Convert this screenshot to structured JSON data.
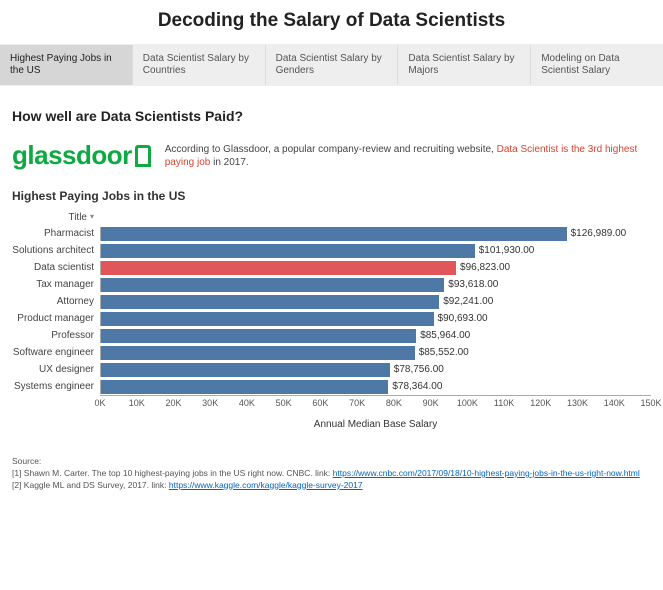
{
  "page_title": "Decoding the Salary of Data Scientists",
  "tabs": [
    {
      "label": "Highest Paying Jobs in the US",
      "active": true
    },
    {
      "label": "Data Scientist Salary by Countries",
      "active": false
    },
    {
      "label": "Data Scientist Salary by Genders",
      "active": false
    },
    {
      "label": "Data Scientist Salary by Majors",
      "active": false
    },
    {
      "label": "Modeling on Data Scientist Salary",
      "active": false
    }
  ],
  "section_heading": "How well are Data Scientists Paid?",
  "glassdoor": {
    "logo_text": "glassdoor",
    "desc_prefix": "According to Glassdoor, a popular company-review and recruiting website, ",
    "desc_highlight": "Data Scientist is the 3rd highest paying job",
    "desc_suffix": " in 2017."
  },
  "chart_data": {
    "type": "bar",
    "title": "Highest Paying Jobs in the US",
    "y_column_header": "Title",
    "xlabel": "Annual Median Base Salary",
    "xlim": [
      0,
      150000
    ],
    "xticks": [
      "0K",
      "10K",
      "20K",
      "30K",
      "40K",
      "50K",
      "60K",
      "70K",
      "80K",
      "90K",
      "100K",
      "110K",
      "120K",
      "130K",
      "140K",
      "150K"
    ],
    "highlight_category": "Data scientist",
    "categories": [
      "Pharmacist",
      "Solutions architect",
      "Data scientist",
      "Tax manager",
      "Attorney",
      "Product manager",
      "Professor",
      "Software engineer",
      "UX designer",
      "Systems engineer"
    ],
    "values": [
      126989.0,
      101930.0,
      96823.0,
      93618.0,
      92241.0,
      90693.0,
      85964.0,
      85552.0,
      78756.0,
      78364.0
    ],
    "value_labels": [
      "$126,989.00",
      "$101,930.00",
      "$96,823.00",
      "$93,618.00",
      "$92,241.00",
      "$90,693.00",
      "$85,964.00",
      "$85,552.00",
      "$78,756.00",
      "$78,364.00"
    ],
    "colors": {
      "default": "#4e79a7",
      "highlight": "#e15759"
    }
  },
  "source": {
    "heading": "Source:",
    "items": [
      {
        "text": "[1] Shawn M. Carter. The top 10 highest-paying jobs in the US right now. CNBC. link: ",
        "link": "https://www.cnbc.com/2017/09/18/10-highest-paying-jobs-in-the-us-right-now.html"
      },
      {
        "text": "[2] Kaggle ML and DS Survey, 2017. link: ",
        "link": "https://www.kaggle.com/kaggle/kaggle-survey-2017"
      }
    ]
  }
}
